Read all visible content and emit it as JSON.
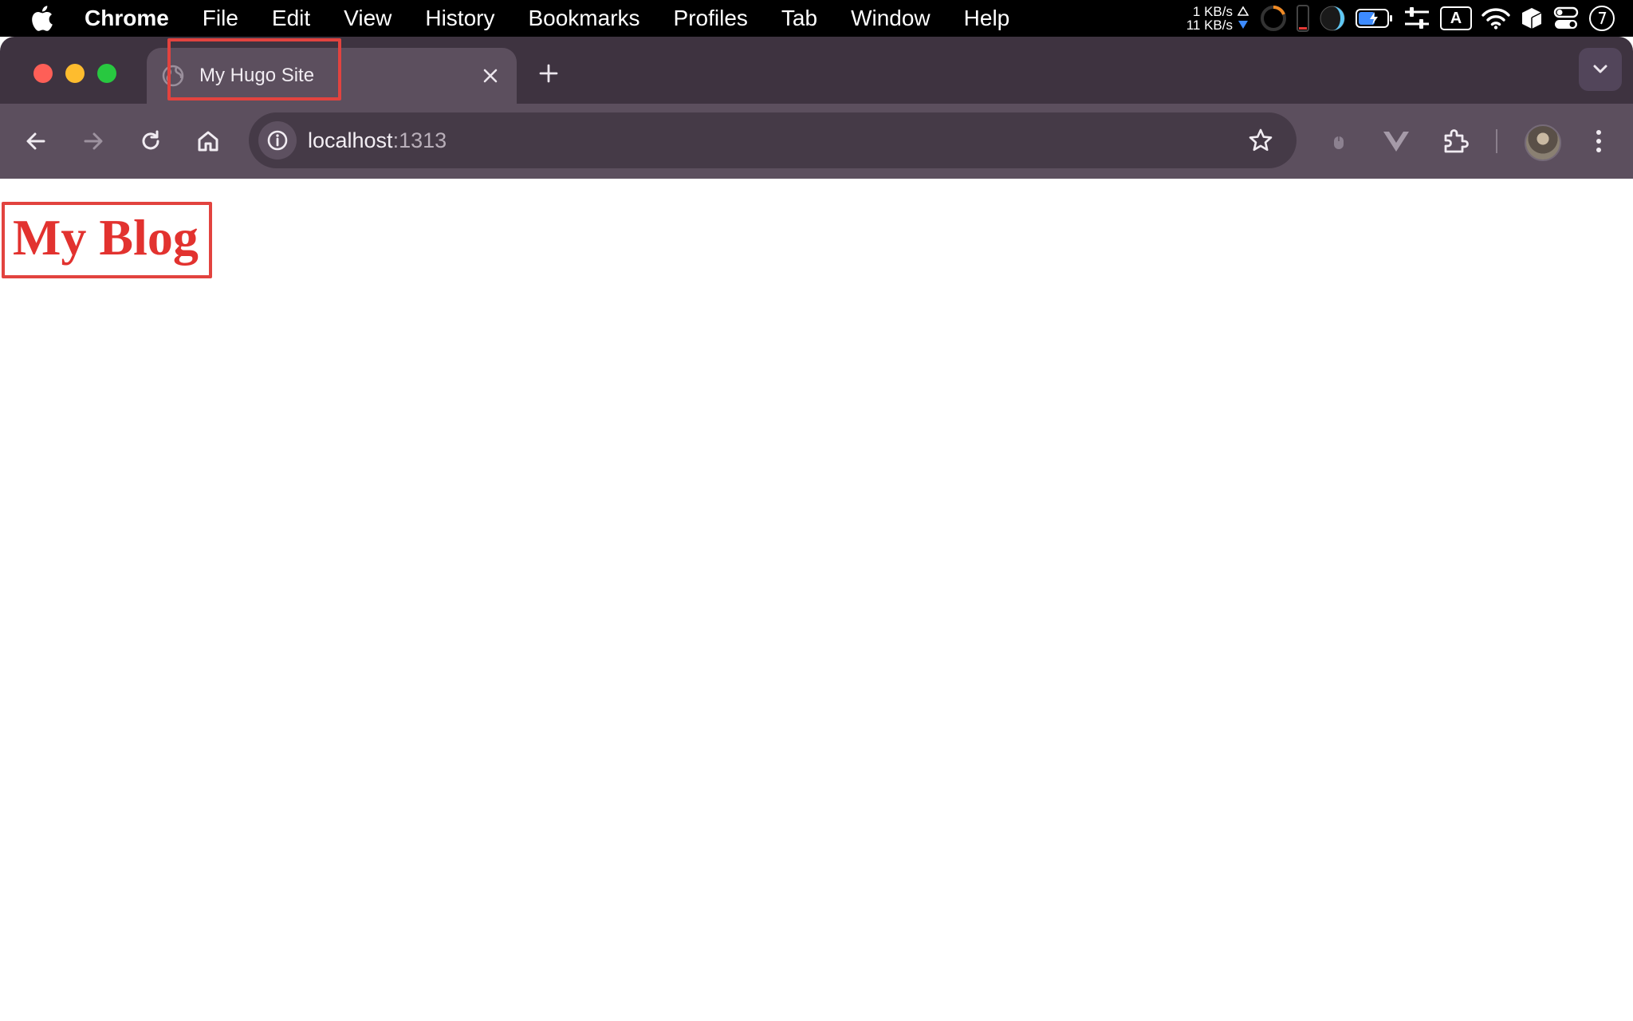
{
  "menubar": {
    "app_name": "Chrome",
    "items": [
      "File",
      "Edit",
      "View",
      "History",
      "Bookmarks",
      "Profiles",
      "Tab",
      "Window",
      "Help"
    ],
    "status": {
      "upload_speed": "1 KB/s",
      "download_speed": "11 KB/s",
      "keyboard_input": "A",
      "icons": [
        "network-activity-icon",
        "cpu-ring-icon",
        "memory-bar-icon",
        "moon-icon",
        "battery-icon",
        "sliders-icon",
        "input-source-icon",
        "wifi-icon",
        "box-icon",
        "control-center-icon",
        "clock-icon"
      ]
    }
  },
  "browser": {
    "tab": {
      "title": "My Hugo Site"
    },
    "address_bar": {
      "host": "localhost",
      "port": ":1313"
    },
    "colors": {
      "tabstrip": "#3e3340",
      "active_tab": "#5c4f5e",
      "omnibox": "#453a47",
      "highlight": "#e2433f"
    }
  },
  "page": {
    "heading": "My Blog",
    "heading_color": "#e2322f"
  }
}
